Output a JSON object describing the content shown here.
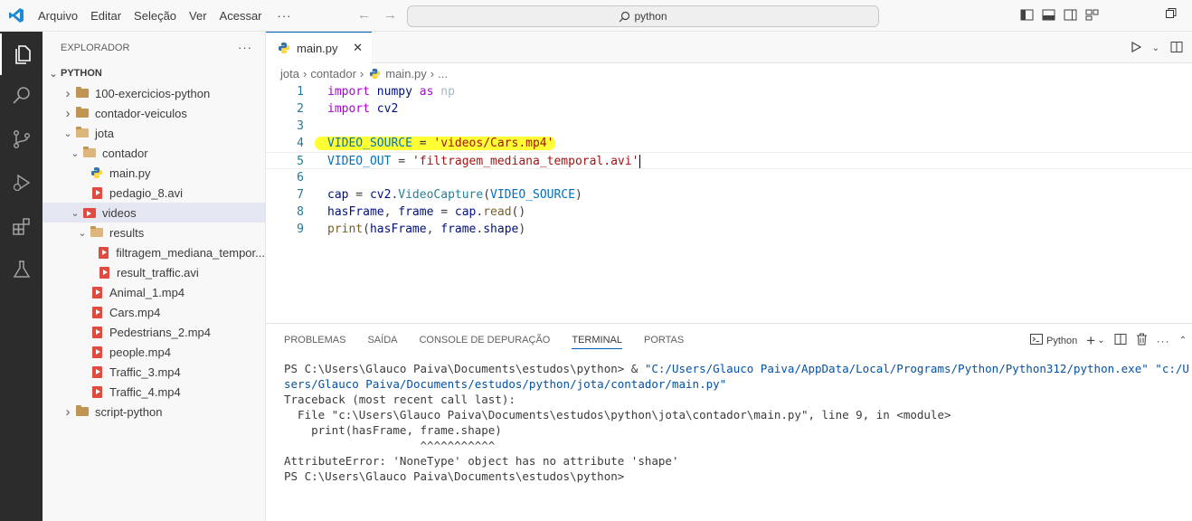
{
  "menubar": {
    "items": [
      "Arquivo",
      "Editar",
      "Seleção",
      "Ver",
      "Acessar"
    ],
    "more": "···"
  },
  "command_center": {
    "text": "python"
  },
  "sidebar": {
    "title": "EXPLORADOR",
    "more": "···",
    "section": "PYTHON",
    "items": [
      {
        "label": "100-exercicios-python",
        "type": "folder",
        "depth": 0,
        "expanded": false
      },
      {
        "label": "contador-veiculos",
        "type": "folder",
        "depth": 0,
        "expanded": false
      },
      {
        "label": "jota",
        "type": "folder",
        "depth": 0,
        "expanded": true
      },
      {
        "label": "contador",
        "type": "folder",
        "depth": 1,
        "expanded": true
      },
      {
        "label": "main.py",
        "type": "python",
        "depth": 2
      },
      {
        "label": "pedagio_8.avi",
        "type": "video",
        "depth": 2
      },
      {
        "label": "videos",
        "type": "video-folder",
        "depth": 1,
        "expanded": true,
        "selected": true
      },
      {
        "label": "results",
        "type": "folder",
        "depth": 2,
        "expanded": true
      },
      {
        "label": "filtragem_mediana_tempor...",
        "type": "video",
        "depth": 3
      },
      {
        "label": "result_traffic.avi",
        "type": "video",
        "depth": 3
      },
      {
        "label": "Animal_1.mp4",
        "type": "video",
        "depth": 2
      },
      {
        "label": "Cars.mp4",
        "type": "video",
        "depth": 2
      },
      {
        "label": "Pedestrians_2.mp4",
        "type": "video",
        "depth": 2
      },
      {
        "label": "people.mp4",
        "type": "video",
        "depth": 2
      },
      {
        "label": "Traffic_3.mp4",
        "type": "video",
        "depth": 2
      },
      {
        "label": "Traffic_4.mp4",
        "type": "video",
        "depth": 2
      },
      {
        "label": "script-python",
        "type": "folder",
        "depth": 0,
        "expanded": false
      }
    ]
  },
  "editor": {
    "tab": {
      "label": "main.py",
      "close": "✕"
    },
    "breadcrumb": [
      "jota",
      "contador",
      "main.py",
      "..."
    ],
    "lines": [
      {
        "n": "1",
        "parts": [
          [
            "kw",
            "import"
          ],
          [
            "plain",
            " "
          ],
          [
            "mod2",
            "numpy"
          ],
          [
            "plain",
            " "
          ],
          [
            "kw",
            "as"
          ],
          [
            "plain",
            " "
          ],
          [
            "dim",
            "np"
          ]
        ]
      },
      {
        "n": "2",
        "parts": [
          [
            "kw",
            "import"
          ],
          [
            "plain",
            " "
          ],
          [
            "mod2",
            "cv2"
          ]
        ]
      },
      {
        "n": "3",
        "parts": []
      },
      {
        "n": "4",
        "highlight": true,
        "parts": [
          [
            "var",
            "VIDEO_SOURCE"
          ],
          [
            "plain",
            " = "
          ],
          [
            "str",
            "'videos/Cars.mp4'"
          ]
        ]
      },
      {
        "n": "5",
        "current": true,
        "parts": [
          [
            "var",
            "VIDEO_OUT"
          ],
          [
            "plain",
            " = "
          ],
          [
            "str",
            "'filtragem_mediana_temporal.avi'"
          ]
        ]
      },
      {
        "n": "6",
        "parts": []
      },
      {
        "n": "7",
        "parts": [
          [
            "mod2",
            "cap"
          ],
          [
            "plain",
            " = "
          ],
          [
            "mod2",
            "cv2"
          ],
          [
            "plain",
            "."
          ],
          [
            "mod",
            "VideoCapture"
          ],
          [
            "plain",
            "("
          ],
          [
            "var",
            "VIDEO_SOURCE"
          ],
          [
            "plain",
            ")"
          ]
        ]
      },
      {
        "n": "8",
        "parts": [
          [
            "mod2",
            "hasFrame"
          ],
          [
            "plain",
            ", "
          ],
          [
            "mod2",
            "frame"
          ],
          [
            "plain",
            " = "
          ],
          [
            "mod2",
            "cap"
          ],
          [
            "plain",
            "."
          ],
          [
            "fn",
            "read"
          ],
          [
            "plain",
            "()"
          ]
        ]
      },
      {
        "n": "9",
        "parts": [
          [
            "fn",
            "print"
          ],
          [
            "plain",
            "("
          ],
          [
            "mod2",
            "hasFrame"
          ],
          [
            "plain",
            ", "
          ],
          [
            "mod2",
            "frame"
          ],
          [
            "plain",
            "."
          ],
          [
            "mod2",
            "shape"
          ],
          [
            "plain",
            ")"
          ]
        ]
      }
    ]
  },
  "panel": {
    "tabs": [
      "PROBLEMAS",
      "SAÍDA",
      "CONSOLE DE DEPURAÇÃO",
      "TERMINAL",
      "PORTAS"
    ],
    "active_tab": "TERMINAL",
    "terminal_name": "Python",
    "terminal_lines": [
      [
        [
          "plain",
          "PS C:\\Users\\Glauco Paiva\\Documents\\estudos\\python> & "
        ],
        [
          "tstr",
          "\"C:/Users/Glauco Paiva/AppData/Local/Programs/Python/Python312/python.exe\""
        ],
        [
          "plain",
          " "
        ],
        [
          "tstr",
          "\"c:/U"
        ]
      ],
      [
        [
          "tstr",
          "sers/Glauco Paiva/Documents/estudos/python/jota/contador/main.py\""
        ]
      ],
      [
        [
          "plain",
          "Traceback (most recent call last):"
        ]
      ],
      [
        [
          "plain",
          "  File \"c:\\Users\\Glauco Paiva\\Documents\\estudos\\python\\jota\\contador\\main.py\", line 9, in <module>"
        ]
      ],
      [
        [
          "plain",
          "    print(hasFrame, frame.shape)"
        ]
      ],
      [
        [
          "plain",
          "                    ^^^^^^^^^^^"
        ]
      ],
      [
        [
          "plain",
          "AttributeError: 'NoneType' object has no attribute 'shape'"
        ]
      ],
      [
        [
          "plain",
          "PS C:\\Users\\Glauco Paiva\\Documents\\estudos\\python>"
        ]
      ]
    ]
  },
  "colors": {
    "accent": "#005fb8",
    "activity_bg": "#2c2c2c",
    "highlight": "#ffff33",
    "folder": "#c09553",
    "video": "#e04a3f",
    "python_blue": "#3572a5",
    "python_yellow": "#ffd43b"
  }
}
